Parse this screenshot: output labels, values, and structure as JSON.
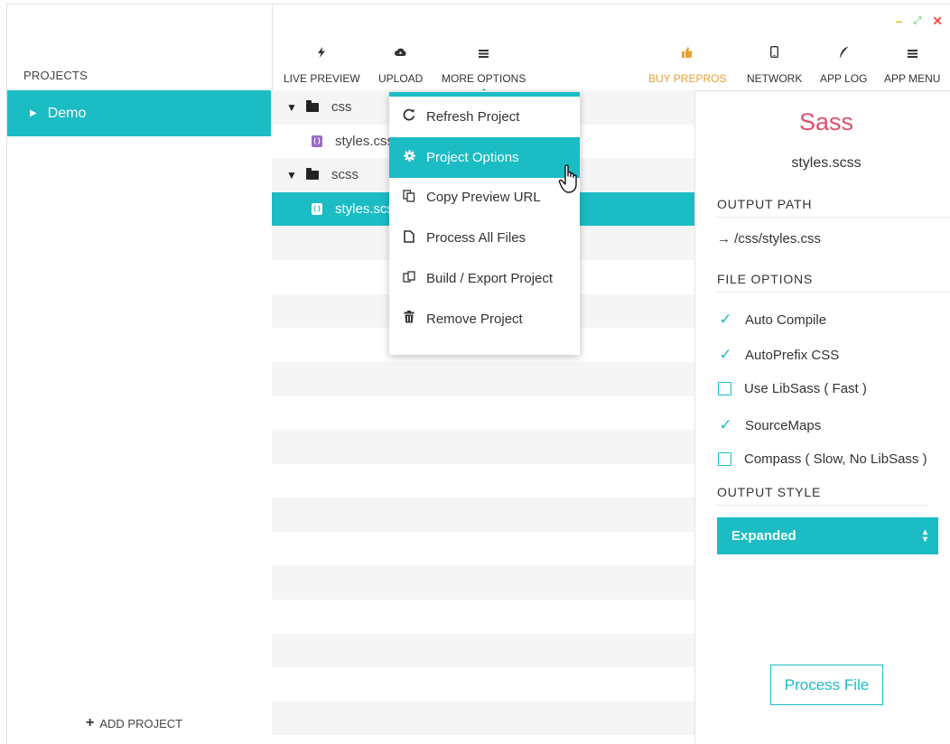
{
  "window": {
    "controls": {
      "minimize": "–",
      "maximize": "⤢",
      "close": "✕"
    }
  },
  "left": {
    "header": "PROJECTS",
    "projects": [
      {
        "label": "Demo",
        "selected": true
      }
    ],
    "add_project": "ADD PROJECT"
  },
  "toolbar": {
    "live_preview": "LIVE PREVIEW",
    "upload": "UPLOAD",
    "more_options": "MORE OPTIONS",
    "buy_prepros": "BUY PREPROS",
    "network": "NETWORK",
    "app_log": "APP LOG",
    "app_menu": "APP MENU",
    "icons": {
      "live_preview": "lightning-icon",
      "upload": "cloud-upload-icon",
      "more_options": "menu-icon",
      "buy_prepros": "thumbs-up-icon",
      "network": "mobile-icon",
      "app_log": "feather-icon",
      "app_menu": "menu-icon"
    }
  },
  "tree": {
    "rows": [
      {
        "type": "folder",
        "label": "css"
      },
      {
        "type": "file",
        "label": "styles.css"
      },
      {
        "type": "folder",
        "label": "scss"
      },
      {
        "type": "file",
        "label": "styles.scss",
        "selected": true
      }
    ]
  },
  "dropdown": {
    "items": [
      {
        "label": "Refresh Project",
        "icon": "refresh-icon"
      },
      {
        "label": "Project Options",
        "icon": "gear-icon",
        "hover": true
      },
      {
        "label": "Copy Preview URL",
        "icon": "copy-icon"
      },
      {
        "label": "Process All Files",
        "icon": "file-icon"
      },
      {
        "label": "Build / Export Project",
        "icon": "export-icon"
      },
      {
        "label": "Remove Project",
        "icon": "trash-icon"
      }
    ]
  },
  "right": {
    "language": "Sass",
    "file_name": "styles.scss",
    "output_path_label": "OUTPUT PATH",
    "output_path": "→ /css/styles.css",
    "file_options_label": "FILE OPTIONS",
    "options": [
      {
        "label": "Auto Compile",
        "checked": true
      },
      {
        "label": "AutoPrefix CSS",
        "checked": true
      },
      {
        "label": "Use LibSass ( Fast )",
        "checked": false
      },
      {
        "label": "SourceMaps",
        "checked": true
      },
      {
        "label": "Compass ( Slow, No LibSass )",
        "checked": false
      }
    ],
    "output_style_label": "OUTPUT STYLE",
    "output_style": "Expanded",
    "process_button": "Process File"
  },
  "colors": {
    "accent": "#1bbcc4",
    "language": "#e0506b",
    "prepros": "#e8a033"
  }
}
